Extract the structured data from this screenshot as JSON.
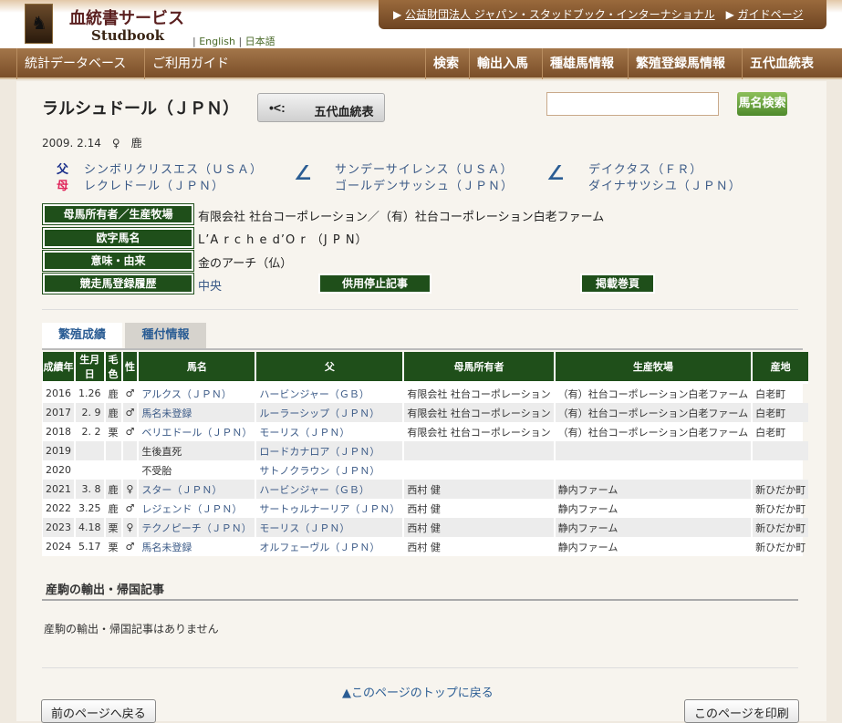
{
  "header": {
    "site_title": "血統書サービス",
    "site_sub": "Studbook",
    "lang_sep": "|",
    "lang_en": "English",
    "lang_ja": "日本語",
    "top_links": [
      "公益財団法人 ジャパン・スタッドブック・インターナショナル",
      "ガイドページ"
    ]
  },
  "nav": {
    "left": [
      "統計データベース",
      "ご利用ガイド"
    ],
    "right": [
      "検索",
      "輸出入馬",
      "種雄馬情報",
      "繁殖登録馬情報",
      "五代血統表"
    ]
  },
  "horse": {
    "name": "ラルシュドール（ＪＰＮ）",
    "pedigree_button": "五代血統表",
    "birth": "2009. 2.14　♀　鹿",
    "sire_label": "父",
    "dam_label": "母",
    "sire": "シンボリクリスエス（ＵＳＡ）",
    "dam": "レクレドール（ＪＰＮ）",
    "dam_sire": "サンデーサイレンス（ＵＳＡ）",
    "dam_dam": "ゴールデンサッシュ（ＪＰＮ）",
    "ddd_sire": "デイクタス（ＦＲ）",
    "ddd_dam": "ダイナサツシユ（ＪＰＮ）"
  },
  "search": {
    "placeholder": "",
    "button": "馬名検索"
  },
  "info": {
    "owner_label": "母馬所有者／生産牧場",
    "owner": "有限会社 社台コーポレーション／（有）社台コーポレーション白老ファーム",
    "roman_label": "欧字馬名",
    "roman": "L’A r c h e  d’O r （J P N）",
    "meaning_label": "意味・由来",
    "meaning": "金のアーチ（仏）",
    "race_label": "競走馬登録履歴",
    "race": "中央",
    "retire_button": "供用停止記事",
    "volume_button": "掲載巻頁"
  },
  "tabs": [
    "繁殖成績",
    "種付情報"
  ],
  "table": {
    "headers": [
      "成績年",
      "生月日",
      "毛色",
      "性",
      "馬名",
      "父",
      "母馬所有者",
      "生産牧場",
      "産地"
    ],
    "rows": [
      [
        "2016",
        "1.26",
        "鹿",
        "♂",
        "アルクス（ＪＰＮ）",
        "ハービンジャー（ＧＢ）",
        "有限会社 社台コーポレーション",
        "（有）社台コーポレーション白老ファーム",
        "白老町"
      ],
      [
        "2017",
        "2. 9",
        "鹿",
        "♂",
        "馬名未登録",
        "ルーラーシップ（ＪＰＮ）",
        "有限会社 社台コーポレーション",
        "（有）社台コーポレーション白老ファーム",
        "白老町"
      ],
      [
        "2018",
        "2. 2",
        "栗",
        "♂",
        "ベリエドール（ＪＰＮ）",
        "モーリス（ＪＰＮ）",
        "有限会社 社台コーポレーション",
        "（有）社台コーポレーション白老ファーム",
        "白老町"
      ],
      [
        "2019",
        "",
        "",
        "",
        "生後直死",
        "ロードカナロア（ＪＰＮ）",
        "",
        "",
        ""
      ],
      [
        "2020",
        "",
        "",
        "",
        "不受胎",
        "サトノクラウン（ＪＰＮ）",
        "",
        "",
        ""
      ],
      [
        "2021",
        "3. 8",
        "鹿",
        "♀",
        "スター（ＪＰＮ）",
        "ハービンジャー（ＧＢ）",
        "西村 健",
        "静内ファーム",
        "新ひだか町"
      ],
      [
        "2022",
        "3.25",
        "鹿",
        "♂",
        "レジェンド（ＪＰＮ）",
        "サートゥルナーリア（ＪＰＮ）",
        "西村 健",
        "静内ファーム",
        "新ひだか町"
      ],
      [
        "2023",
        "4.18",
        "栗",
        "♀",
        "テクノピーチ（ＪＰＮ）",
        "モーリス（ＪＰＮ）",
        "西村 健",
        "静内ファーム",
        "新ひだか町"
      ],
      [
        "2024",
        "5.17",
        "栗",
        "♂",
        "馬名未登録",
        "オルフェーヴル（ＪＰＮ）",
        "西村 健",
        "静内ファーム",
        "新ひだか町"
      ]
    ]
  },
  "export": {
    "title": "産駒の輸出・帰国記事",
    "text": "産駒の輸出・帰国記事はありません"
  },
  "footer": {
    "to_top": "▲このページのトップに戻る",
    "back": "前のページへ戻る",
    "print": "このページを印刷"
  }
}
